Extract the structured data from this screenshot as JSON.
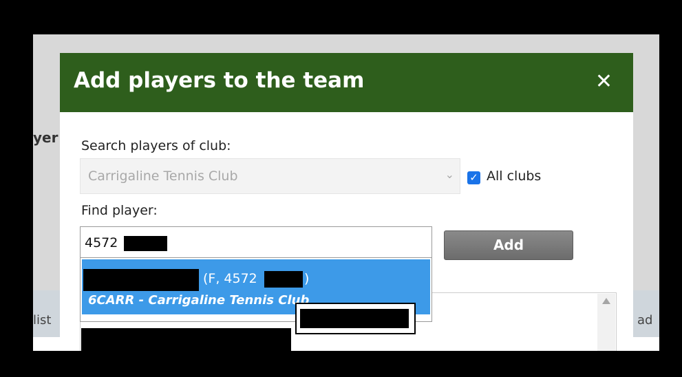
{
  "background": {
    "heading_fragment": "yer",
    "list_fragment": "list",
    "add_fragment": "ad"
  },
  "modal": {
    "title": "Add players to the team",
    "close_glyph": "✕",
    "club_label": "Search players of club:",
    "club_select_value": "Carrigaline Tennis Club",
    "all_clubs_label": "All clubs",
    "all_clubs_checked": true,
    "find_label": "Find player:",
    "find_input_value": "4572",
    "add_button_label": "Add"
  },
  "autocomplete": {
    "items": [
      {
        "line1_prefix": "(F, 4572",
        "line1_suffix": ")",
        "line2": "6CARR - Carrigaline Tennis Club"
      }
    ]
  },
  "colors": {
    "header_green": "#2e5e1c",
    "selection_blue": "#3d9ae8",
    "checkbox_blue": "#1a73e8",
    "add_button_gray": "#7a7a7a"
  }
}
